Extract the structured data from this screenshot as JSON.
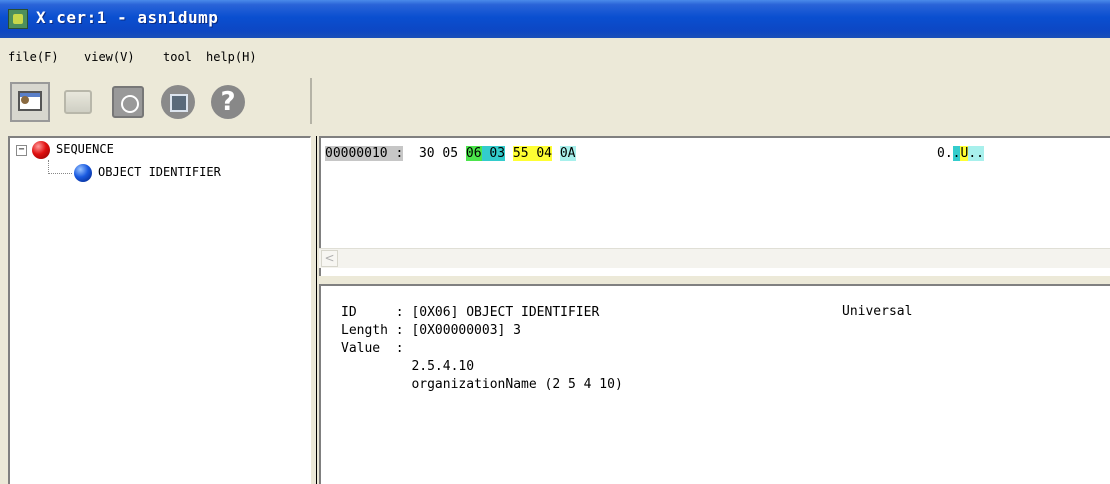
{
  "window": {
    "title": "X.cer:1 - asn1dump"
  },
  "menu": {
    "file": "file(F)",
    "view": "view(V)",
    "tool": "tool",
    "help": "help(H)"
  },
  "toolbar": {
    "icons": [
      "open-icon",
      "folder-icon",
      "power-icon",
      "disk-icon",
      "help-icon"
    ],
    "help_glyph": "?"
  },
  "tree": {
    "root_expander": "−",
    "root_label": "SEQUENCE",
    "child_label": "OBJECT IDENTIFIER"
  },
  "hex": {
    "address": "00000010 :",
    "bytes": [
      "30",
      "05",
      "06",
      "03",
      "55",
      "04",
      "0A"
    ],
    "ascii": [
      "0",
      ".",
      ".",
      "U",
      "."
    ],
    "highlight_colors": {
      "tag": "#4ce44c",
      "length": "#33cccc",
      "value": "#ffff33",
      "value_end": "#a8f0ec"
    },
    "scroll_left": "<"
  },
  "detail": {
    "id_line": "ID     : [0X06] OBJECT IDENTIFIER",
    "class": "Universal",
    "length_line": "Length : [0X00000003] 3",
    "value_line": "Value  :",
    "value_oid": "2.5.4.10",
    "value_name": "organizationName (2 5 4 10)"
  }
}
